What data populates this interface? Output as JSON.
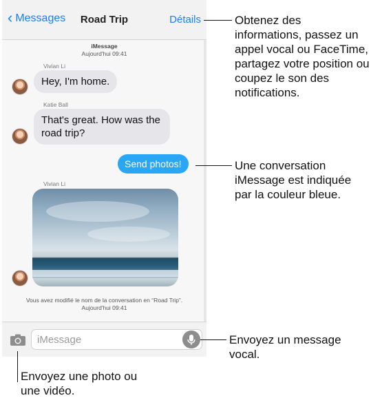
{
  "nav": {
    "back_label": "Messages",
    "title": "Road Trip",
    "details_label": "Détails"
  },
  "thread": {
    "service": "iMessage",
    "timestamp_top": "Aujourd'hui 09:41",
    "messages": [
      {
        "sender": "Vivian Li",
        "text": "Hey, I'm home."
      },
      {
        "sender": "Katie Ball",
        "text": "That's great. How was the road trip?"
      },
      {
        "sender": "",
        "text": "Send photos!"
      },
      {
        "sender": "Vivian Li",
        "text": ""
      }
    ],
    "rename_notice": "Vous avez modifié le nom de la conversation en “Road Trip”.",
    "timestamp_bottom": "Aujourd'hui 09:41"
  },
  "input": {
    "placeholder": "iMessage"
  },
  "callouts": {
    "details": "Obtenez des informations, passez un appel vocal ou FaceTime, partagez votre position ou coupez le son des notifications.",
    "imessage": "Une conversation iMessage est indiquée par la couleur bleue.",
    "voice": "Envoyez un message vocal.",
    "photo": "Envoyez une photo ou une vidéo."
  },
  "colors": {
    "accent": "#1a7ef7",
    "outgoing_bubble": "#29a6f6",
    "incoming_bubble": "#e5e5ea"
  },
  "icons": [
    "chevron-left-icon",
    "camera-icon",
    "microphone-icon"
  ]
}
